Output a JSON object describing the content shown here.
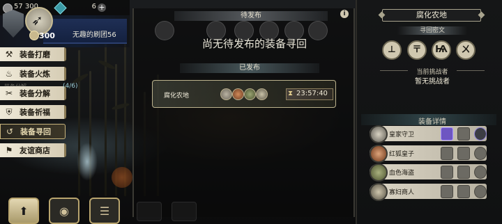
{
  "status": {
    "coins": "57 300",
    "gems": "6"
  },
  "guild": {
    "name": "无趣的刷团56",
    "score": "300"
  },
  "menu": [
    {
      "label": "装备打磨",
      "icon": "hammer-icon",
      "glyph": "⚒"
    },
    {
      "label": "装备火炼",
      "icon": "flame-icon",
      "glyph": "♨"
    },
    {
      "label": "装备分解",
      "icon": "split-icon",
      "glyph": "✂"
    },
    {
      "label": "装备祈福",
      "icon": "pray-icon",
      "glyph": "⛨"
    },
    {
      "label": "装备寻回",
      "icon": "retrieve-icon",
      "glyph": "↺"
    },
    {
      "label": "友谊商店",
      "icon": "shop-icon",
      "glyph": "⚑"
    }
  ],
  "progress_text": "(4/6)",
  "ghost_text": "装备分解",
  "pending": {
    "header": "待发布",
    "empty_message": "尚无待发布的装备寻回"
  },
  "published": {
    "header": "已发布",
    "row": {
      "location": "腐化农地",
      "time": "23:57:40"
    }
  },
  "right": {
    "location_title": "腐化农地",
    "rune_header": "寻回密文",
    "runes": [
      "⊥",
      "〒",
      "Ѩ",
      "ㄨ"
    ],
    "challenger_header": "当前挑战者",
    "challenger_value": "暂无挑战者",
    "equip_header": "装备详情",
    "heroes": [
      {
        "name": "皇家守卫"
      },
      {
        "name": "红狐皇子"
      },
      {
        "name": "血色海盗"
      },
      {
        "name": "寡妇商人"
      }
    ]
  },
  "colors": {
    "accent": "#c8b47c",
    "panel": "#151617",
    "slot_active": "#6e56c2"
  }
}
